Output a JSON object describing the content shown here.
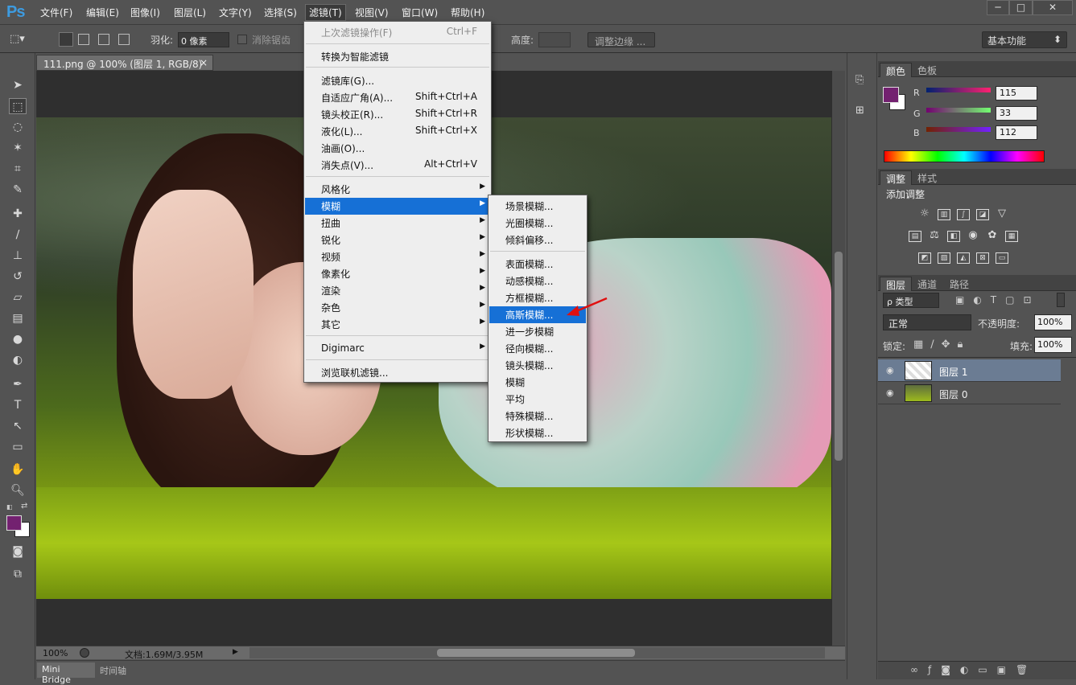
{
  "app": {
    "logo": "Ps",
    "window_buttons": [
      "─",
      "□",
      "✕"
    ]
  },
  "menubar": {
    "items": [
      "文件(F)",
      "编辑(E)",
      "图像(I)",
      "图层(L)",
      "文字(Y)",
      "选择(S)",
      "滤镜(T)",
      "视图(V)",
      "窗口(W)",
      "帮助(H)"
    ],
    "active": "滤镜(T)"
  },
  "options": {
    "feather_label": "羽化:",
    "feather_value": "0 像素",
    "antialias_label": "消除锯齿",
    "height_label": "高度:",
    "refine_button": "调整边缘 ...",
    "workspace": "基本功能"
  },
  "document": {
    "tab_title": "111.png @ 100% (图层 1, RGB/8) *",
    "zoom": "100%",
    "doc_info": "文档:1.69M/3.95M"
  },
  "bottom_tabs": [
    "Mini Bridge",
    "时间轴"
  ],
  "filter_menu": {
    "items": [
      {
        "label": "上次滤镜操作(F)",
        "shortcut": "Ctrl+F",
        "disabled": true
      },
      {
        "label": "转换为智能滤镜"
      },
      {
        "label": "滤镜库(G)..."
      },
      {
        "label": "自适应广角(A)...",
        "shortcut": "Shift+Ctrl+A"
      },
      {
        "label": "镜头校正(R)...",
        "shortcut": "Shift+Ctrl+R"
      },
      {
        "label": "液化(L)...",
        "shortcut": "Shift+Ctrl+X"
      },
      {
        "label": "油画(O)..."
      },
      {
        "label": "消失点(V)...",
        "shortcut": "Alt+Ctrl+V"
      },
      {
        "label": "风格化",
        "submenu": true
      },
      {
        "label": "模糊",
        "submenu": true,
        "highlighted": true
      },
      {
        "label": "扭曲",
        "submenu": true
      },
      {
        "label": "锐化",
        "submenu": true
      },
      {
        "label": "视频",
        "submenu": true
      },
      {
        "label": "像素化",
        "submenu": true
      },
      {
        "label": "渲染",
        "submenu": true
      },
      {
        "label": "杂色",
        "submenu": true
      },
      {
        "label": "其它",
        "submenu": true
      },
      {
        "label": "Digimarc",
        "submenu": true
      },
      {
        "label": "浏览联机滤镜..."
      }
    ]
  },
  "blur_submenu": {
    "items": [
      "场景模糊...",
      "光圈模糊...",
      "倾斜偏移...",
      "表面模糊...",
      "动感模糊...",
      "方框模糊...",
      "高斯模糊...",
      "进一步模糊",
      "径向模糊...",
      "镜头模糊...",
      "模糊",
      "平均",
      "特殊模糊...",
      "形状模糊..."
    ],
    "highlighted": "高斯模糊..."
  },
  "color_panel": {
    "tabs": [
      "颜色",
      "色板"
    ],
    "r_label": "R",
    "g_label": "G",
    "b_label": "B",
    "r": "115",
    "g": "33",
    "b": "112",
    "fg_color": "#732170"
  },
  "adjust_panel": {
    "tabs": [
      "调整",
      "样式"
    ],
    "title": "添加调整"
  },
  "layers_panel": {
    "tabs": [
      "图层",
      "通道",
      "路径"
    ],
    "filter_kind": "ρ 类型",
    "blend_mode": "正常",
    "opacity_label": "不透明度:",
    "opacity": "100%",
    "lock_label": "锁定:",
    "fill_label": "填充:",
    "fill": "100%",
    "layers": [
      {
        "name": "图层 1",
        "selected": true
      },
      {
        "name": "图层 0",
        "selected": false
      }
    ]
  }
}
